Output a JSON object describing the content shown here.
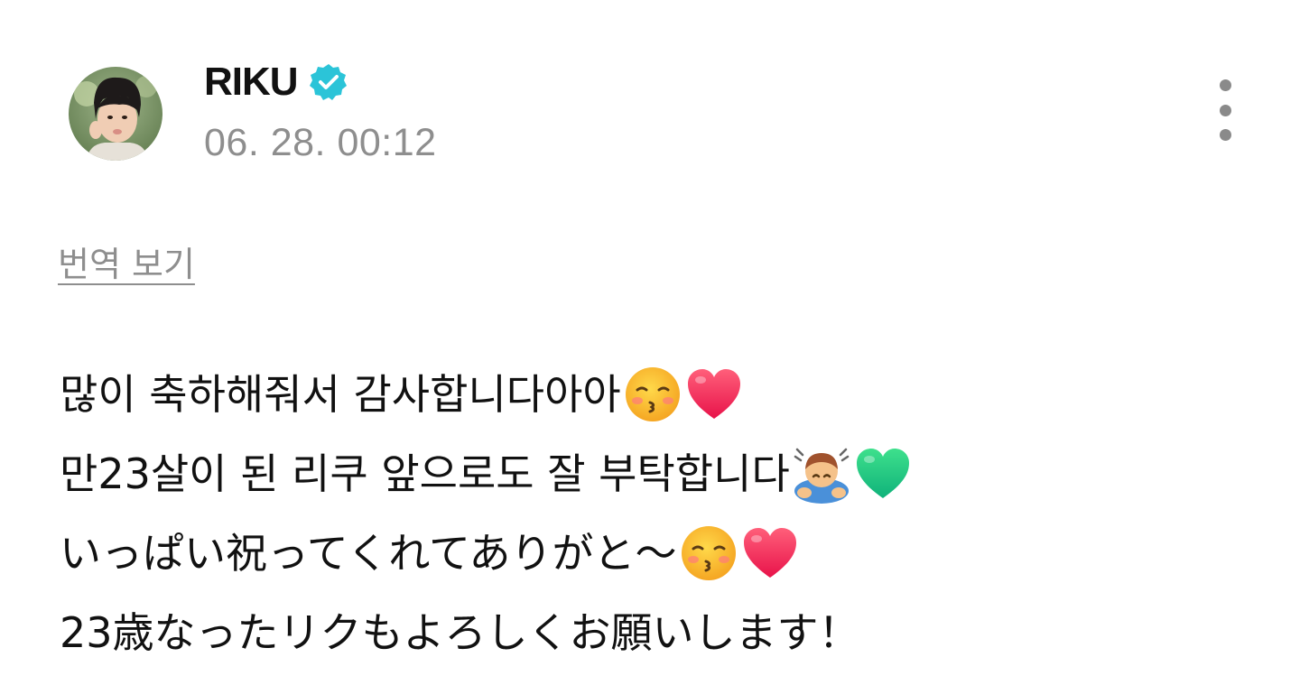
{
  "post": {
    "author": {
      "name": "RIKU",
      "verified_icon": "verified-badge-icon",
      "avatar": "profile-photo"
    },
    "timestamp": "06. 28. 00:12",
    "more_icon": "more-vertical-icon",
    "translate_label": "번역 보기",
    "lines": [
      {
        "text": "많이 축하해줘서 감사합니다아아",
        "emojis": [
          "kissing-face-icon",
          "red-heart-icon"
        ]
      },
      {
        "text": "만23살이 된 리쿠 앞으로도 잘 부탁합니다",
        "emojis": [
          "person-bowing-icon",
          "green-heart-icon"
        ]
      },
      {
        "text": "いっぱい祝ってくれてありがと〜",
        "emojis": [
          "kissing-face-icon",
          "red-heart-icon"
        ]
      },
      {
        "text": "23歳なったリクもよろしくお願いします！",
        "emojis": []
      }
    ]
  },
  "colors": {
    "verified_badge": "#2bc4d8",
    "muted_text": "#8e8e8e",
    "body_text": "#111111"
  }
}
